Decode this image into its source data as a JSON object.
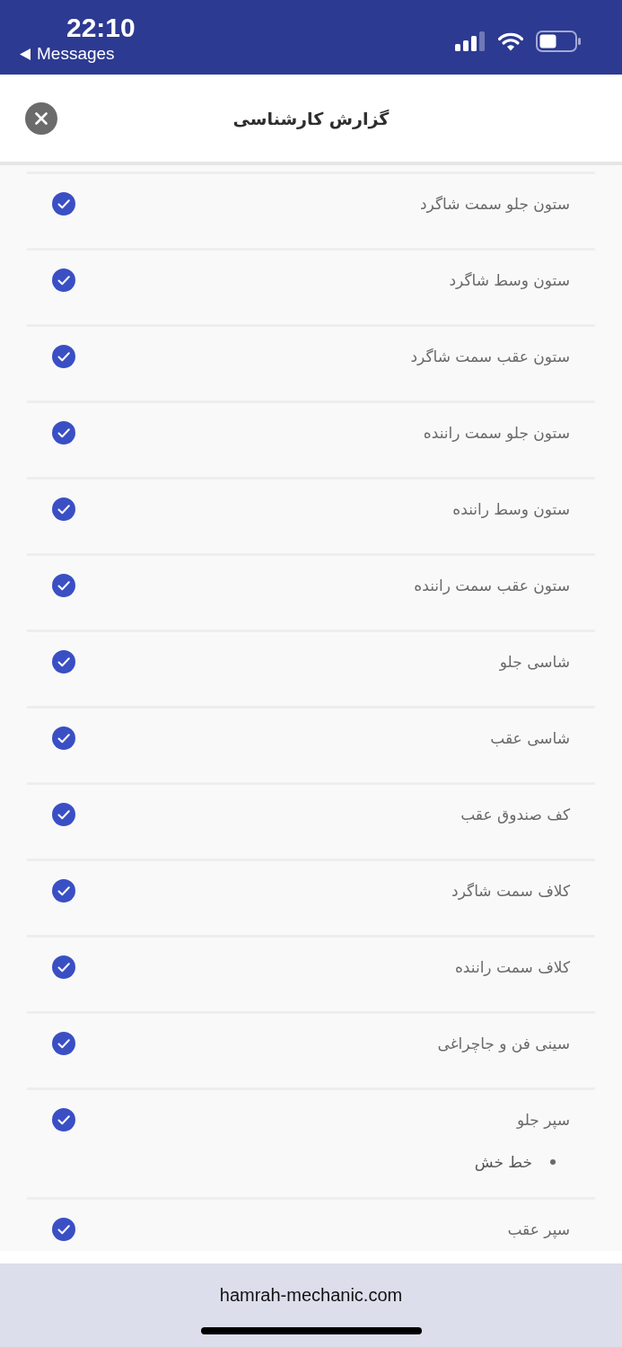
{
  "status_bar": {
    "time": "22:10",
    "back_label": "Messages"
  },
  "header": {
    "title": "گزارش کارشناسی"
  },
  "items": [
    {
      "label": "ستون جلو سمت شاگرد",
      "checked": true
    },
    {
      "label": "ستون وسط شاگرد",
      "checked": true
    },
    {
      "label": "ستون عقب سمت شاگرد",
      "checked": true
    },
    {
      "label": "ستون جلو سمت راننده",
      "checked": true
    },
    {
      "label": "ستون وسط راننده",
      "checked": true
    },
    {
      "label": "ستون عقب سمت راننده",
      "checked": true
    },
    {
      "label": "شاسی جلو",
      "checked": true
    },
    {
      "label": "شاسی عقب",
      "checked": true
    },
    {
      "label": "کف صندوق عقب",
      "checked": true
    },
    {
      "label": "کلاف سمت شاگرد",
      "checked": true
    },
    {
      "label": "کلاف سمت راننده",
      "checked": true
    },
    {
      "label": "سینی فن و جاچراغی",
      "checked": true
    },
    {
      "label": "سپر جلو",
      "checked": true,
      "notes": [
        "خط خش"
      ]
    },
    {
      "label": "سپر عقب",
      "checked": true
    }
  ],
  "footer": {
    "url": "hamrah-mechanic.com"
  }
}
